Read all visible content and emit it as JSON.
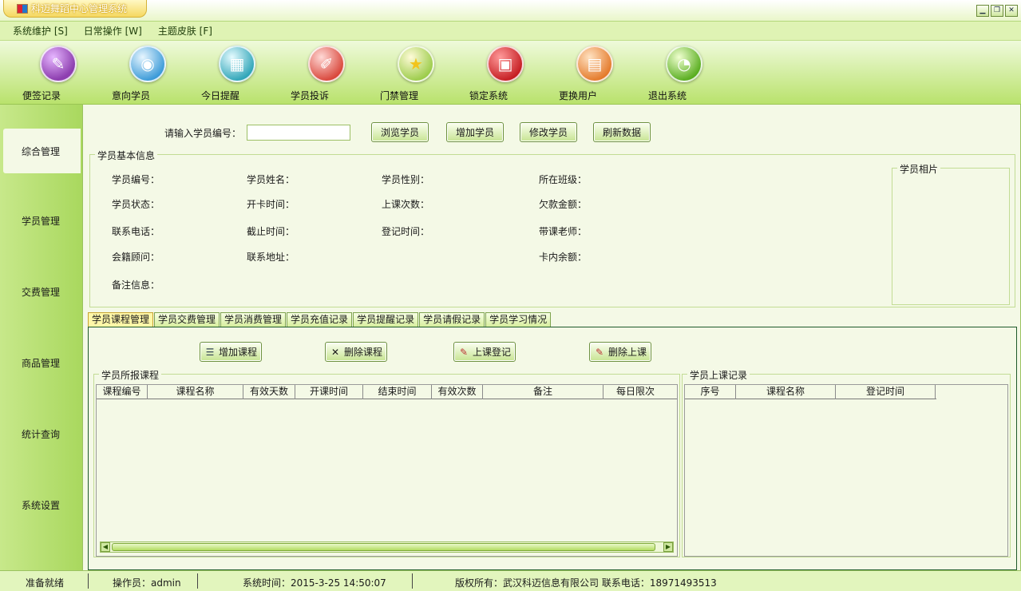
{
  "window": {
    "title": "科迈舞蹈中心管理系统",
    "buttons": [
      "minimize",
      "restore",
      "close"
    ]
  },
  "menu": [
    {
      "label": "系统维护 [S]"
    },
    {
      "label": "日常操作 [W]"
    },
    {
      "label": "主题皮肤 [F]"
    }
  ],
  "toolbar": [
    {
      "label": "便签记录",
      "icon": "note-pen-icon",
      "color": "#8e3fb0"
    },
    {
      "label": "意向学员",
      "icon": "cd-user-icon",
      "color": "#3a9ad8"
    },
    {
      "label": "今日提醒",
      "icon": "reminder-icon",
      "color": "#2fa5b8"
    },
    {
      "label": "学员投诉",
      "icon": "complaint-pencil-icon",
      "color": "#d9463a"
    },
    {
      "label": "门禁管理",
      "icon": "star-access-icon",
      "color": "#e4c12e"
    },
    {
      "label": "锁定系统",
      "icon": "lock-system-icon",
      "color": "#c51d22"
    },
    {
      "label": "更换用户",
      "icon": "switch-user-icon",
      "color": "#e47a2a"
    },
    {
      "label": "退出系统",
      "icon": "exit-icon",
      "color": "#58ad1e"
    }
  ],
  "sidebar": [
    {
      "label": "综合管理",
      "active": true
    },
    {
      "label": "学员管理"
    },
    {
      "label": "交费管理"
    },
    {
      "label": "商品管理"
    },
    {
      "label": "统计查询"
    },
    {
      "label": "系统设置"
    }
  ],
  "search": {
    "label": "请输入学员编号：",
    "value": "",
    "buttons": [
      "浏览学员",
      "增加学员",
      "修改学员",
      "刷新数据"
    ]
  },
  "info": {
    "legend": "学员基本信息",
    "photo_legend": "学员相片",
    "fields": [
      "学员编号：",
      "学员姓名：",
      "学员性别：",
      "所在班级：",
      "学员状态：",
      "开卡时间：",
      "上课次数：",
      "欠款金额：",
      "联系电话：",
      "截止时间：",
      "登记时间：",
      "带课老师：",
      "会籍顾问：",
      "联系地址：",
      "卡内余额：",
      "备注信息："
    ]
  },
  "tabs": [
    "学员课程管理",
    "学员交费管理",
    "学员消费管理",
    "学员充值记录",
    "学员提醒记录",
    "学员请假记录",
    "学员学习情况"
  ],
  "course_actions": [
    "增加课程",
    "删除课程",
    "上课登记",
    "删除上课"
  ],
  "courses": {
    "legend": "学员所报课程",
    "columns": [
      "课程编号",
      "课程名称",
      "有效天数",
      "开课时间",
      "结束时间",
      "有效次数",
      "备注",
      "每日限次"
    ]
  },
  "attendance": {
    "legend": "学员上课记录",
    "columns": [
      "序号",
      "课程名称",
      "登记时间"
    ]
  },
  "status": {
    "ready": "准备就绪",
    "operator": "操作员：admin",
    "time": "系统时间：2015-3-25 14:50:07",
    "copyright": "版权所有：武汉科迈信息有限公司  联系电话：18971493513"
  }
}
